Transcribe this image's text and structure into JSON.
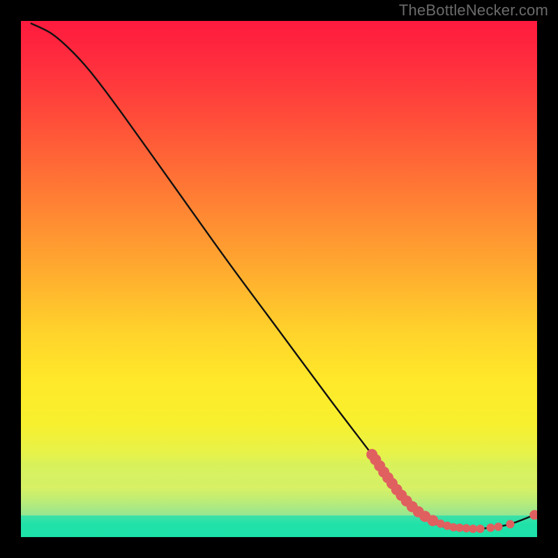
{
  "watermark": "TheBottleNecker.com",
  "chart_data": {
    "type": "line",
    "title": "",
    "xlabel": "",
    "ylabel": "",
    "xlim": [
      0,
      100
    ],
    "ylim": [
      0,
      100
    ],
    "curve": {
      "name": "bottleneck-curve",
      "points": [
        {
          "x": 2.0,
          "y": 99.5
        },
        {
          "x": 6.0,
          "y": 97.5
        },
        {
          "x": 10.0,
          "y": 94.0
        },
        {
          "x": 14.0,
          "y": 89.5
        },
        {
          "x": 20.0,
          "y": 81.5
        },
        {
          "x": 30.0,
          "y": 67.5
        },
        {
          "x": 40.0,
          "y": 53.5
        },
        {
          "x": 50.0,
          "y": 40.0
        },
        {
          "x": 60.0,
          "y": 26.5
        },
        {
          "x": 68.0,
          "y": 16.0
        },
        {
          "x": 74.0,
          "y": 8.0
        },
        {
          "x": 78.0,
          "y": 4.0
        },
        {
          "x": 82.0,
          "y": 2.0
        },
        {
          "x": 88.0,
          "y": 1.6
        },
        {
          "x": 94.0,
          "y": 2.3
        },
        {
          "x": 99.5,
          "y": 4.3
        }
      ]
    },
    "markers": {
      "name": "highlight-points",
      "color": "#e06060",
      "radius_large": 8,
      "radius_small": 6,
      "points": [
        {
          "x": 68.0,
          "y": 16.0,
          "r": 8
        },
        {
          "x": 68.7,
          "y": 15.0,
          "r": 8
        },
        {
          "x": 69.5,
          "y": 13.8,
          "r": 8
        },
        {
          "x": 70.3,
          "y": 12.6,
          "r": 8
        },
        {
          "x": 71.1,
          "y": 11.5,
          "r": 8
        },
        {
          "x": 71.9,
          "y": 10.4,
          "r": 8
        },
        {
          "x": 72.8,
          "y": 9.2,
          "r": 8
        },
        {
          "x": 73.7,
          "y": 8.1,
          "r": 8
        },
        {
          "x": 74.7,
          "y": 7.0,
          "r": 8
        },
        {
          "x": 75.8,
          "y": 5.9,
          "r": 8
        },
        {
          "x": 77.0,
          "y": 4.9,
          "r": 8
        },
        {
          "x": 78.3,
          "y": 4.0,
          "r": 8
        },
        {
          "x": 79.8,
          "y": 3.2,
          "r": 8
        },
        {
          "x": 81.3,
          "y": 2.6,
          "r": 6
        },
        {
          "x": 82.6,
          "y": 2.2,
          "r": 6
        },
        {
          "x": 83.8,
          "y": 1.9,
          "r": 6
        },
        {
          "x": 85.0,
          "y": 1.8,
          "r": 6
        },
        {
          "x": 86.3,
          "y": 1.7,
          "r": 6
        },
        {
          "x": 87.6,
          "y": 1.6,
          "r": 6
        },
        {
          "x": 89.0,
          "y": 1.6,
          "r": 6
        },
        {
          "x": 91.0,
          "y": 1.8,
          "r": 6
        },
        {
          "x": 92.5,
          "y": 2.0,
          "r": 6
        },
        {
          "x": 94.8,
          "y": 2.5,
          "r": 6
        },
        {
          "x": 99.5,
          "y": 4.3,
          "r": 7
        }
      ]
    },
    "background": {
      "type": "vertical-gradient",
      "stops": [
        {
          "pos": 0.0,
          "color": "#ff1a3e"
        },
        {
          "pos": 0.5,
          "color": "#ffc02c"
        },
        {
          "pos": 0.78,
          "color": "#f7f02e"
        },
        {
          "pos": 0.96,
          "color": "#3fd6b0"
        },
        {
          "pos": 1.0,
          "color": "#1fd0b4"
        }
      ]
    }
  }
}
